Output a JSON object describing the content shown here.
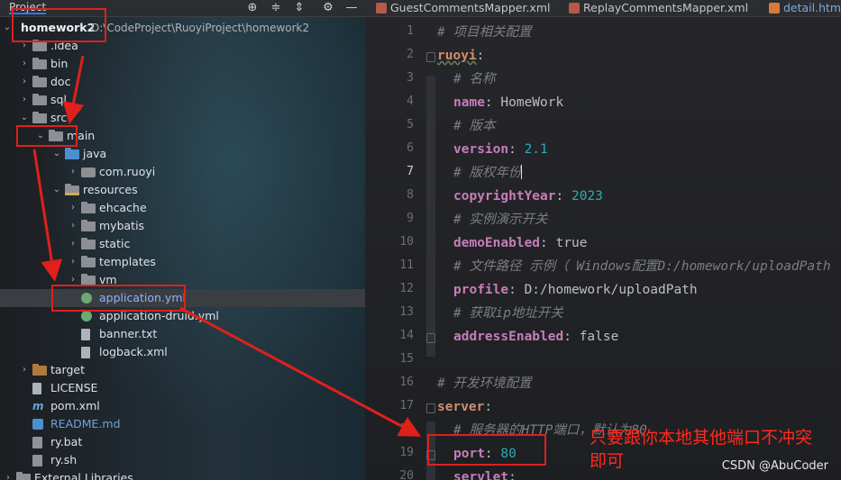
{
  "project_panel": {
    "title": "Project",
    "toolbar_icons": [
      "target-icon",
      "collapse-icon",
      "expand-icon",
      "gear-icon",
      "minimize-icon"
    ],
    "root": {
      "name": "homework2",
      "path": "D:\\CodeProject\\RuoyiProject\\homework2"
    },
    "tree": [
      {
        "label": ".idea",
        "icon": "folder-icon"
      },
      {
        "label": "bin",
        "icon": "folder-icon"
      },
      {
        "label": "doc",
        "icon": "folder-icon"
      },
      {
        "label": "sql",
        "icon": "folder-icon"
      },
      {
        "label": "src",
        "icon": "folder-icon"
      },
      {
        "label": "main",
        "icon": "folder-icon"
      },
      {
        "label": "java",
        "icon": "source-folder-icon"
      },
      {
        "label": "com.ruoyi",
        "icon": "package-icon"
      },
      {
        "label": "resources",
        "icon": "resources-folder-icon"
      },
      {
        "label": "ehcache",
        "icon": "folder-icon"
      },
      {
        "label": "mybatis",
        "icon": "folder-icon"
      },
      {
        "label": "static",
        "icon": "folder-icon"
      },
      {
        "label": "templates",
        "icon": "folder-icon"
      },
      {
        "label": "vm",
        "icon": "folder-icon"
      },
      {
        "label": "application.yml",
        "icon": "yaml-file-icon"
      },
      {
        "label": "application-druid.yml",
        "icon": "yaml-file-icon"
      },
      {
        "label": "banner.txt",
        "icon": "text-file-icon"
      },
      {
        "label": "logback.xml",
        "icon": "xml-file-icon"
      },
      {
        "label": "target",
        "icon": "excluded-folder-icon"
      },
      {
        "label": "LICENSE",
        "icon": "text-file-icon"
      },
      {
        "label": "pom.xml",
        "icon": "maven-file-icon"
      },
      {
        "label": "README.md",
        "icon": "markdown-file-icon"
      },
      {
        "label": "ry.bat",
        "icon": "batch-file-icon"
      },
      {
        "label": "ry.sh",
        "icon": "shell-file-icon"
      },
      {
        "label": "External Libraries",
        "icon": "library-icon"
      }
    ]
  },
  "tabs": [
    {
      "label": "GuestCommentsMapper.xml"
    },
    {
      "label": "ReplayCommentsMapper.xml"
    },
    {
      "label": "detail.html"
    }
  ],
  "editor": {
    "current_line": 7,
    "lines": [
      {
        "n": "1",
        "comment": "# 项目相关配置"
      },
      {
        "n": "2",
        "key": "ruoyi",
        "colon": ":"
      },
      {
        "n": "3",
        "comment": "# 名称"
      },
      {
        "n": "4",
        "key": "name",
        "colon": ": ",
        "value": "HomeWork"
      },
      {
        "n": "5",
        "comment": "# 版本"
      },
      {
        "n": "6",
        "key": "version",
        "colon": ": ",
        "value": "2.1"
      },
      {
        "n": "7",
        "comment": "# 版权年份"
      },
      {
        "n": "8",
        "key": "copyrightYear",
        "colon": ": ",
        "value": "2023"
      },
      {
        "n": "9",
        "comment": "# 实例演示开关"
      },
      {
        "n": "10",
        "key": "demoEnabled",
        "colon": ": ",
        "value": "true"
      },
      {
        "n": "11",
        "comment": "# 文件路径 示例（ Windows配置D:/homework/uploadPath"
      },
      {
        "n": "12",
        "key": "profile",
        "colon": ": ",
        "value": "D:/homework/uploadPath"
      },
      {
        "n": "13",
        "comment": "# 获取ip地址开关"
      },
      {
        "n": "14",
        "key": "addressEnabled",
        "colon": ": ",
        "value": "false"
      },
      {
        "n": "15"
      },
      {
        "n": "16",
        "comment": "# 开发环境配置"
      },
      {
        "n": "17",
        "key": "server",
        "colon": ":"
      },
      {
        "n": "18",
        "comment": "# 服务器的HTTP端口，默认为80"
      },
      {
        "n": "19",
        "key": "port",
        "colon": ": ",
        "value": "80"
      },
      {
        "n": "20",
        "key": "servlet",
        "colon": ":"
      }
    ]
  },
  "annotation": {
    "line1": "只要跟你本地其他端口不冲突",
    "line2": "即可",
    "color": "#ff2a1f"
  },
  "watermark": "CSDN @AbuCoder"
}
